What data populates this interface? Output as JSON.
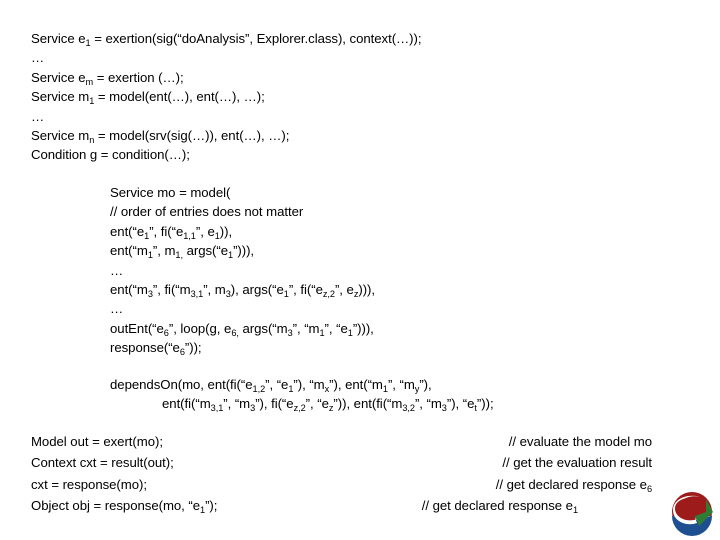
{
  "slide": {
    "background_color": "#ffffff",
    "text_color": "#000000"
  },
  "declarations": {
    "lines": [
      {
        "id": "decl-1",
        "html": "Service e<sub>1</sub> = exertion(sig(“doAnalysis”, Explorer.class), context(…));"
      },
      {
        "id": "decl-2",
        "html": "…"
      },
      {
        "id": "decl-3",
        "html": "Service e<sub>m</sub> = exertion (…);"
      },
      {
        "id": "decl-4",
        "html": "Service m<sub>1</sub> = model(ent(…), ent(…), …);"
      },
      {
        "id": "decl-5",
        "html": "…"
      },
      {
        "id": "decl-6",
        "html": "Service m<sub>n</sub> = model(srv(sig(…)), ent(…), …);"
      },
      {
        "id": "decl-7",
        "html": "Condition g = condition(…);"
      }
    ]
  },
  "model_body": {
    "lines": [
      {
        "id": "model-1",
        "html": "Service mo = model("
      },
      {
        "id": "model-2",
        "html": "// order of entries does not matter"
      },
      {
        "id": "model-3",
        "html": "ent(“e<sub>1</sub>”, fi(“e<sub>1,1</sub>”, e<sub>1</sub>)),"
      },
      {
        "id": "model-4",
        "html": "ent(“m<sub>1</sub>”, m<sub>1,</sub> args(“e<sub>1</sub>”))),"
      },
      {
        "id": "model-5",
        "html": "…"
      },
      {
        "id": "model-6",
        "html": "ent(“m<sub>3</sub>”, fi(“m<sub>3,1</sub>”, m<sub>3</sub>), args(“e<sub>1</sub>”, fi(“e<sub>z,2</sub>”, e<sub>z</sub>))),"
      },
      {
        "id": "model-7",
        "html": "…"
      },
      {
        "id": "model-8",
        "html": "outEnt(“e<sub>6</sub>”, loop(g, e<sub>6,</sub> args(“m<sub>3</sub>”, “m<sub>1</sub>”, “e<sub>1</sub>”))),"
      },
      {
        "id": "model-9",
        "html": "response(“e<sub>6</sub>”));"
      }
    ]
  },
  "depends_on": {
    "lines": [
      {
        "id": "depends-1",
        "indent": false,
        "html": "dependsOn(mo, ent(fi(“e<sub>1,2</sub>”, “e<sub>1</sub>”), “m<sub>x</sub>”), ent(“m<sub>1</sub>”, “m<sub>y</sub>”),"
      },
      {
        "id": "depends-2",
        "indent": true,
        "html": "ent(fi(“m<sub>3,1</sub>”, “m<sub>3</sub>”), fi(“e<sub>z,2</sub>”, “e<sub>z</sub>”)), ent(fi(“m<sub>3,2</sub>”, “m<sub>3</sub>”), “e<sub>t</sub>”));"
      }
    ]
  },
  "bottom": {
    "code_lines": [
      {
        "id": "bottom-code-1",
        "html": "Model out = exert(mo);"
      },
      {
        "id": "bottom-code-2",
        "html": "Context cxt = result(out);"
      },
      {
        "id": "bottom-code-3",
        "html": "cxt = response(mo);"
      },
      {
        "id": "bottom-code-4",
        "html": "Object obj = response(mo, “e<sub>1</sub>”);"
      }
    ],
    "comment_lines": [
      {
        "id": "bottom-comment-1",
        "shift_left": false,
        "html": "// evaluate the model mo"
      },
      {
        "id": "bottom-comment-2",
        "shift_left": false,
        "html": "// get the evaluation result"
      },
      {
        "id": "bottom-comment-3",
        "shift_left": false,
        "html": "// get declared response e<sub>6</sub>"
      },
      {
        "id": "bottom-comment-4",
        "shift_left": true,
        "html": "// get declared response e<sub>1</sub>"
      }
    ]
  },
  "logo": {
    "name": "sorcer-logo-icon",
    "colors": {
      "red": "#9e1b1b",
      "green": "#2e7d32",
      "blue": "#1d4f91",
      "white": "#ffffff"
    }
  }
}
